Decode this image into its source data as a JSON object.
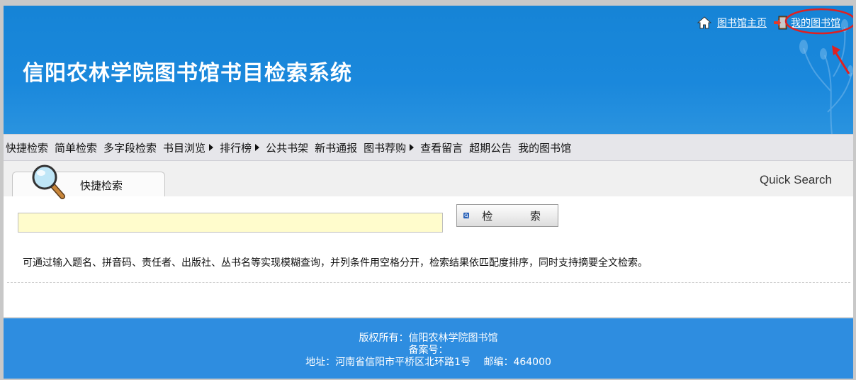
{
  "header": {
    "title": "信阳农林学院图书馆书目检索系统",
    "links": {
      "home": "图书馆主页",
      "my_library": "我的图书馆"
    },
    "colors": {
      "background": "#1a88dc",
      "annotation": "#e02020"
    }
  },
  "nav": {
    "items": [
      {
        "label": "快捷检索",
        "has_submenu": false
      },
      {
        "label": "简单检索",
        "has_submenu": false
      },
      {
        "label": "多字段检索",
        "has_submenu": false
      },
      {
        "label": "书目浏览",
        "has_submenu": true
      },
      {
        "label": "排行榜",
        "has_submenu": true
      },
      {
        "label": "公共书架",
        "has_submenu": false
      },
      {
        "label": "新书通报",
        "has_submenu": false
      },
      {
        "label": "图书荐购",
        "has_submenu": true
      },
      {
        "label": "查看留言",
        "has_submenu": false
      },
      {
        "label": "超期公告",
        "has_submenu": false
      },
      {
        "label": "我的图书馆",
        "has_submenu": false
      }
    ]
  },
  "search": {
    "tab_label": "快捷检索",
    "english_title": "Quick Search",
    "input_value": "",
    "button_label": "检 索",
    "hint": "可通过输入题名、拼音码、责任者、出版社、丛书名等实现模糊查询，并列条件用空格分开，检索结果依匹配度排序，同时支持摘要全文检索。"
  },
  "footer": {
    "copyright": "版权所有：信阳农林学院图书馆",
    "record": "备案号：",
    "address": "地址：河南省信阳市平桥区北环路1号　  邮编：464000"
  }
}
